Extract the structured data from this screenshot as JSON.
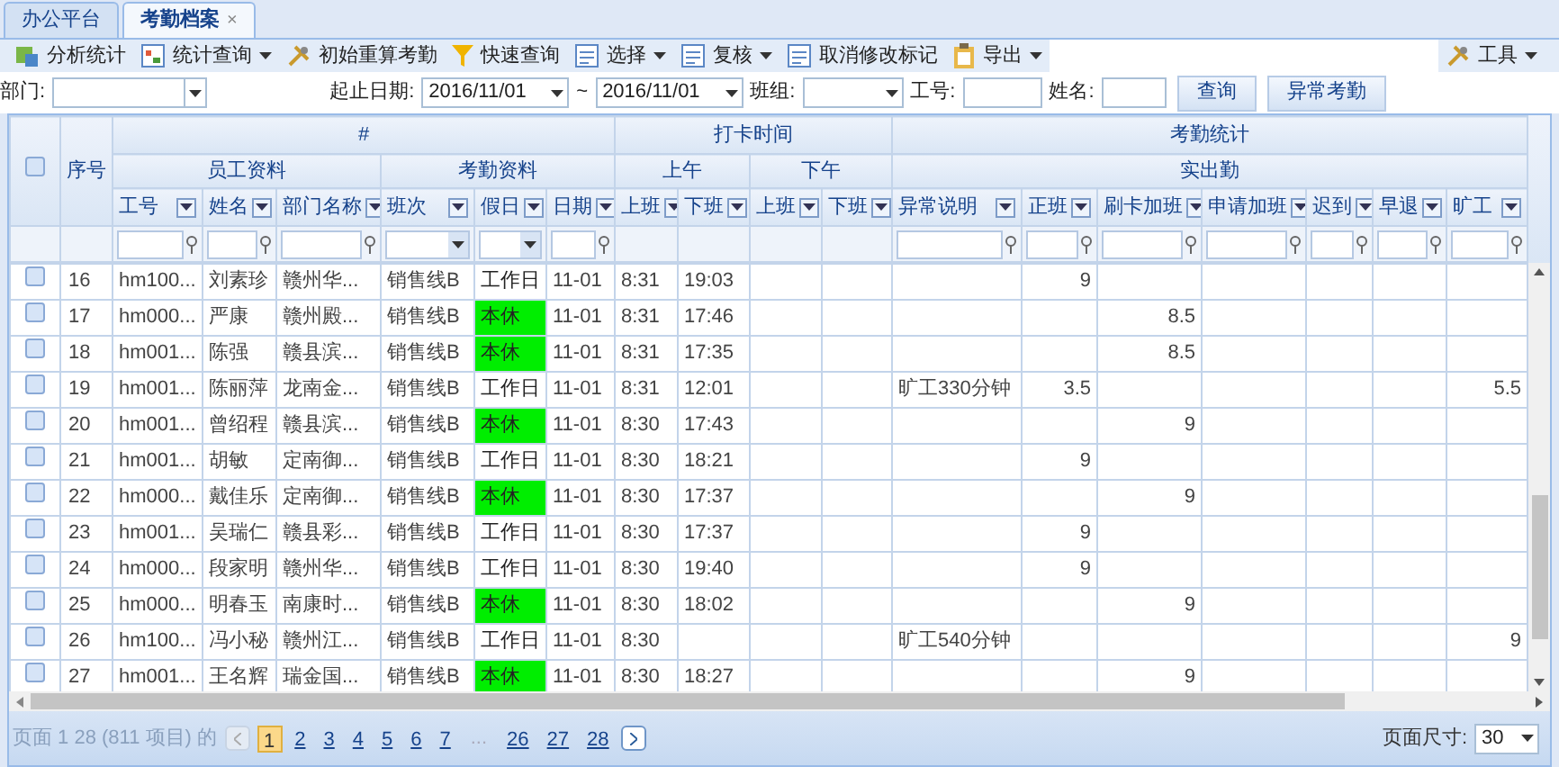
{
  "tabs": [
    {
      "label": "办公平台",
      "selected": false,
      "closable": false
    },
    {
      "label": "考勤档案",
      "selected": true,
      "closable": true
    }
  ],
  "close_glyph": "×",
  "toolbar": {
    "items": [
      {
        "label": "分析统计",
        "dropdown": false
      },
      {
        "label": "统计查询",
        "dropdown": true
      },
      {
        "label": "初始重算考勤",
        "dropdown": false
      },
      {
        "label": "快速查询",
        "dropdown": false
      },
      {
        "label": "选择",
        "dropdown": true
      },
      {
        "label": "复核",
        "dropdown": true
      },
      {
        "label": "取消修改标记",
        "dropdown": false
      },
      {
        "label": "导出",
        "dropdown": true
      }
    ],
    "right": {
      "label": "工具",
      "dropdown": true
    }
  },
  "filters": {
    "department": {
      "label": "部门:"
    },
    "date_range": {
      "label": "起止日期:",
      "from": "2016/11/01",
      "separator": "~",
      "to": "2016/11/01"
    },
    "team": {
      "label": "班组:"
    },
    "emp_id": {
      "label": "工号:"
    },
    "name": {
      "label": "姓名:"
    },
    "buttons": [
      "查询",
      "异常考勤"
    ]
  },
  "grid": {
    "select_all": {
      "checked": false
    },
    "seq_header": "序号",
    "columns": [
      {
        "label": "#",
        "children": [
          {
            "label": "员工资料",
            "children": [
              {
                "label": "工号",
                "kind": "text_filter"
              },
              {
                "label": "姓名",
                "kind": "text_filter"
              },
              {
                "label": "部门名称",
                "kind": "text_filter"
              }
            ]
          },
          {
            "label": "考勤资料",
            "children": [
              {
                "label": "班次",
                "kind": "select_filter"
              },
              {
                "label": "假日",
                "kind": "select_filter"
              },
              {
                "label": "日期",
                "kind": "text_filter"
              }
            ]
          }
        ]
      },
      {
        "label": "打卡时间",
        "children": [
          {
            "label": "上午",
            "children": [
              {
                "label": "上班",
                "kind": "no_filter"
              },
              {
                "label": "下班",
                "kind": "no_filter"
              }
            ]
          },
          {
            "label": "下午",
            "children": [
              {
                "label": "上班",
                "kind": "no_filter"
              },
              {
                "label": "下班",
                "kind": "no_filter"
              }
            ]
          }
        ]
      },
      {
        "label": "考勤统计",
        "children": [
          {
            "label": "实出勤",
            "children": [
              {
                "label": "异常说明",
                "kind": "text_filter"
              },
              {
                "label": "正班",
                "kind": "text_filter"
              },
              {
                "label": "刷卡加班",
                "kind": "text_filter"
              },
              {
                "label": "申请加班",
                "kind": "text_filter"
              },
              {
                "label": "迟到",
                "kind": "text_filter"
              },
              {
                "label": "早退",
                "kind": "text_filter"
              },
              {
                "label": "旷工",
                "kind": "text_filter"
              }
            ]
          }
        ]
      }
    ],
    "rows": [
      {
        "checked": false,
        "seq": "16",
        "emp_id": "hm100...",
        "name": "刘素珍",
        "department": "赣州华...",
        "shift": "销售线B",
        "holiday": "工作日",
        "rest_day": false,
        "date": "11-01",
        "am_in": "8:31",
        "am_out": "19:03",
        "regular_hours": "9"
      },
      {
        "checked": false,
        "seq": "17",
        "emp_id": "hm000...",
        "name": "严康",
        "department": "赣州殿...",
        "shift": "销售线B",
        "holiday": "本休",
        "rest_day": true,
        "date": "11-01",
        "am_in": "8:31",
        "am_out": "17:46",
        "card_overtime": "8.5"
      },
      {
        "checked": false,
        "seq": "18",
        "emp_id": "hm001...",
        "name": "陈强",
        "department": "赣县滨...",
        "shift": "销售线B",
        "holiday": "本休",
        "rest_day": true,
        "date": "11-01",
        "am_in": "8:31",
        "am_out": "17:35",
        "card_overtime": "8.5"
      },
      {
        "checked": false,
        "seq": "19",
        "emp_id": "hm001...",
        "name": "陈丽萍",
        "department": "龙南金...",
        "shift": "销售线B",
        "holiday": "工作日",
        "rest_day": false,
        "date": "11-01",
        "am_in": "8:31",
        "am_out": "12:01",
        "remark": "旷工330分钟",
        "regular_hours": "3.5",
        "absent": "5.5"
      },
      {
        "checked": false,
        "seq": "20",
        "emp_id": "hm001...",
        "name": "曾绍程",
        "department": "赣县滨...",
        "shift": "销售线B",
        "holiday": "本休",
        "rest_day": true,
        "date": "11-01",
        "am_in": "8:30",
        "am_out": "17:43",
        "card_overtime": "9"
      },
      {
        "checked": false,
        "seq": "21",
        "emp_id": "hm001...",
        "name": "胡敏",
        "department": "定南御...",
        "shift": "销售线B",
        "holiday": "工作日",
        "rest_day": false,
        "date": "11-01",
        "am_in": "8:30",
        "am_out": "18:21",
        "regular_hours": "9"
      },
      {
        "checked": false,
        "seq": "22",
        "emp_id": "hm000...",
        "name": "戴佳乐",
        "department": "定南御...",
        "shift": "销售线B",
        "holiday": "本休",
        "rest_day": true,
        "date": "11-01",
        "am_in": "8:30",
        "am_out": "17:37",
        "card_overtime": "9"
      },
      {
        "checked": false,
        "seq": "23",
        "emp_id": "hm001...",
        "name": "吴瑞仁",
        "department": "赣县彩...",
        "shift": "销售线B",
        "holiday": "工作日",
        "rest_day": false,
        "date": "11-01",
        "am_in": "8:30",
        "am_out": "17:37",
        "regular_hours": "9"
      },
      {
        "checked": false,
        "seq": "24",
        "emp_id": "hm000...",
        "name": "段家明",
        "department": "赣州华...",
        "shift": "销售线B",
        "holiday": "工作日",
        "rest_day": false,
        "date": "11-01",
        "am_in": "8:30",
        "am_out": "19:40",
        "regular_hours": "9"
      },
      {
        "checked": false,
        "seq": "25",
        "emp_id": "hm000...",
        "name": "明春玉",
        "department": "南康时...",
        "shift": "销售线B",
        "holiday": "本休",
        "rest_day": true,
        "date": "11-01",
        "am_in": "8:30",
        "am_out": "18:02",
        "card_overtime": "9"
      },
      {
        "checked": false,
        "seq": "26",
        "emp_id": "hm100...",
        "name": "冯小秘",
        "department": "赣州江...",
        "shift": "销售线B",
        "holiday": "工作日",
        "rest_day": false,
        "date": "11-01",
        "am_in": "8:30",
        "remark": "旷工540分钟",
        "absent": "9"
      },
      {
        "checked": false,
        "seq": "27",
        "emp_id": "hm001...",
        "name": "王名辉",
        "department": "瑞金国...",
        "shift": "销售线B",
        "holiday": "本休",
        "rest_day": true,
        "date": "11-01",
        "am_in": "8:30",
        "am_out": "18:27",
        "card_overtime": "9"
      }
    ]
  },
  "pager": {
    "summary": "页面 1 28 (811 项目) 的",
    "prev": {
      "disabled": true
    },
    "pages": [
      {
        "label": "1",
        "selected": true
      },
      {
        "label": "2",
        "selected": false
      },
      {
        "label": "3",
        "selected": false
      },
      {
        "label": "4",
        "selected": false
      },
      {
        "label": "5",
        "selected": false
      },
      {
        "label": "6",
        "selected": false
      },
      {
        "label": "7",
        "selected": false
      }
    ],
    "ellipsis": "...",
    "last_pages": [
      {
        "label": "26",
        "selected": false
      },
      {
        "label": "27",
        "selected": false
      },
      {
        "label": "28",
        "selected": false
      }
    ],
    "next": {
      "disabled": false
    },
    "page_size_label": "页面尺寸:",
    "page_size": "30"
  }
}
